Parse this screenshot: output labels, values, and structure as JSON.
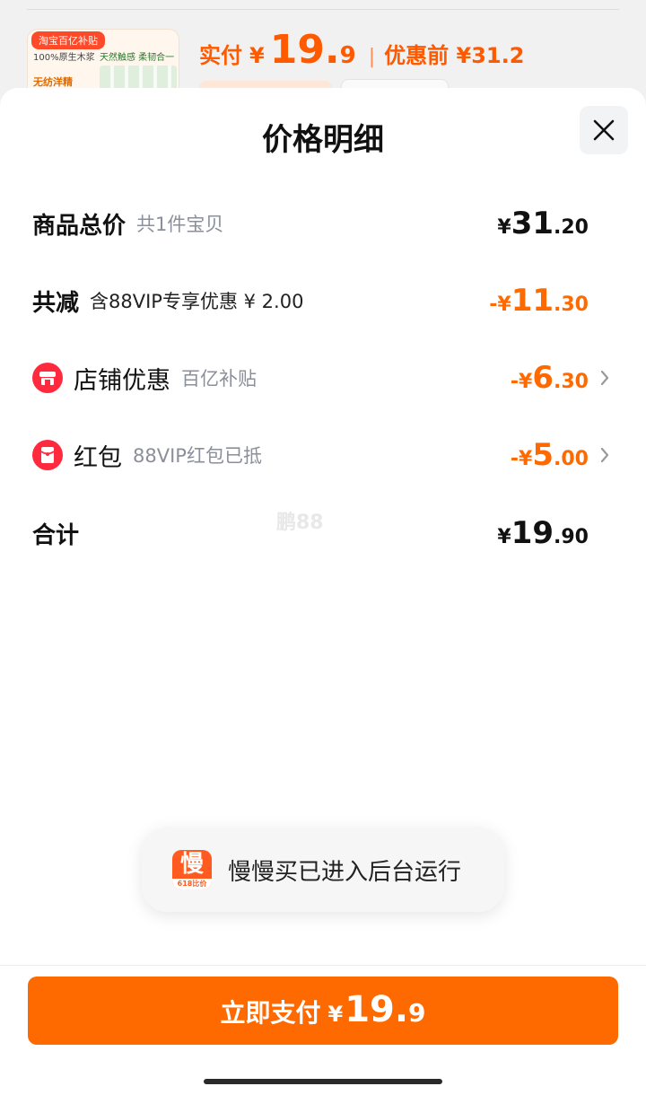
{
  "background": {
    "thumb_badge": "淘宝百亿补贴",
    "thumb_text1": "100%原生木浆",
    "thumb_text2": "天然触感 柔韧合一",
    "thumb_text3": "无纺洋精",
    "actual_label": "实付",
    "actual_yen": "¥",
    "actual_int": "19.",
    "actual_dec": "9",
    "separator": "|",
    "before_label": "优惠前 ¥31.2"
  },
  "sheet": {
    "title": "价格明细",
    "close_icon": "close-icon"
  },
  "rows": {
    "total": {
      "label": "商品总价",
      "sub": "共1件宝贝",
      "yen": "¥",
      "int": "31",
      "dec": ".20"
    },
    "reduce": {
      "label": "共减",
      "sub": "含88VIP专享优惠 ¥ 2.00",
      "yen": "-¥",
      "int": "11",
      "dec": ".30"
    },
    "store": {
      "label": "店铺优惠",
      "sub": "百亿补贴",
      "yen": "-¥",
      "int": "6",
      "dec": ".30",
      "icon": "store-icon"
    },
    "redpacket": {
      "label": "红包",
      "sub": "88VIP红包已抵",
      "yen": "-¥",
      "int": "5",
      "dec": ".00",
      "icon": "red-packet-icon"
    },
    "sum": {
      "label": "合计",
      "yen": "¥",
      "int": "19",
      "dec": ".90"
    }
  },
  "watermark": "鹏88",
  "toast": {
    "app_glyph": "慢",
    "app_strip": "618比价",
    "text": "慢慢买已进入后台运行"
  },
  "footer": {
    "pay_label": "立即支付",
    "pay_yen": "¥",
    "pay_int": "19.",
    "pay_dec": "9"
  },
  "colors": {
    "accent": "#ff6a00",
    "icon_red": "#ff2a3d",
    "muted": "#8a8f99"
  }
}
